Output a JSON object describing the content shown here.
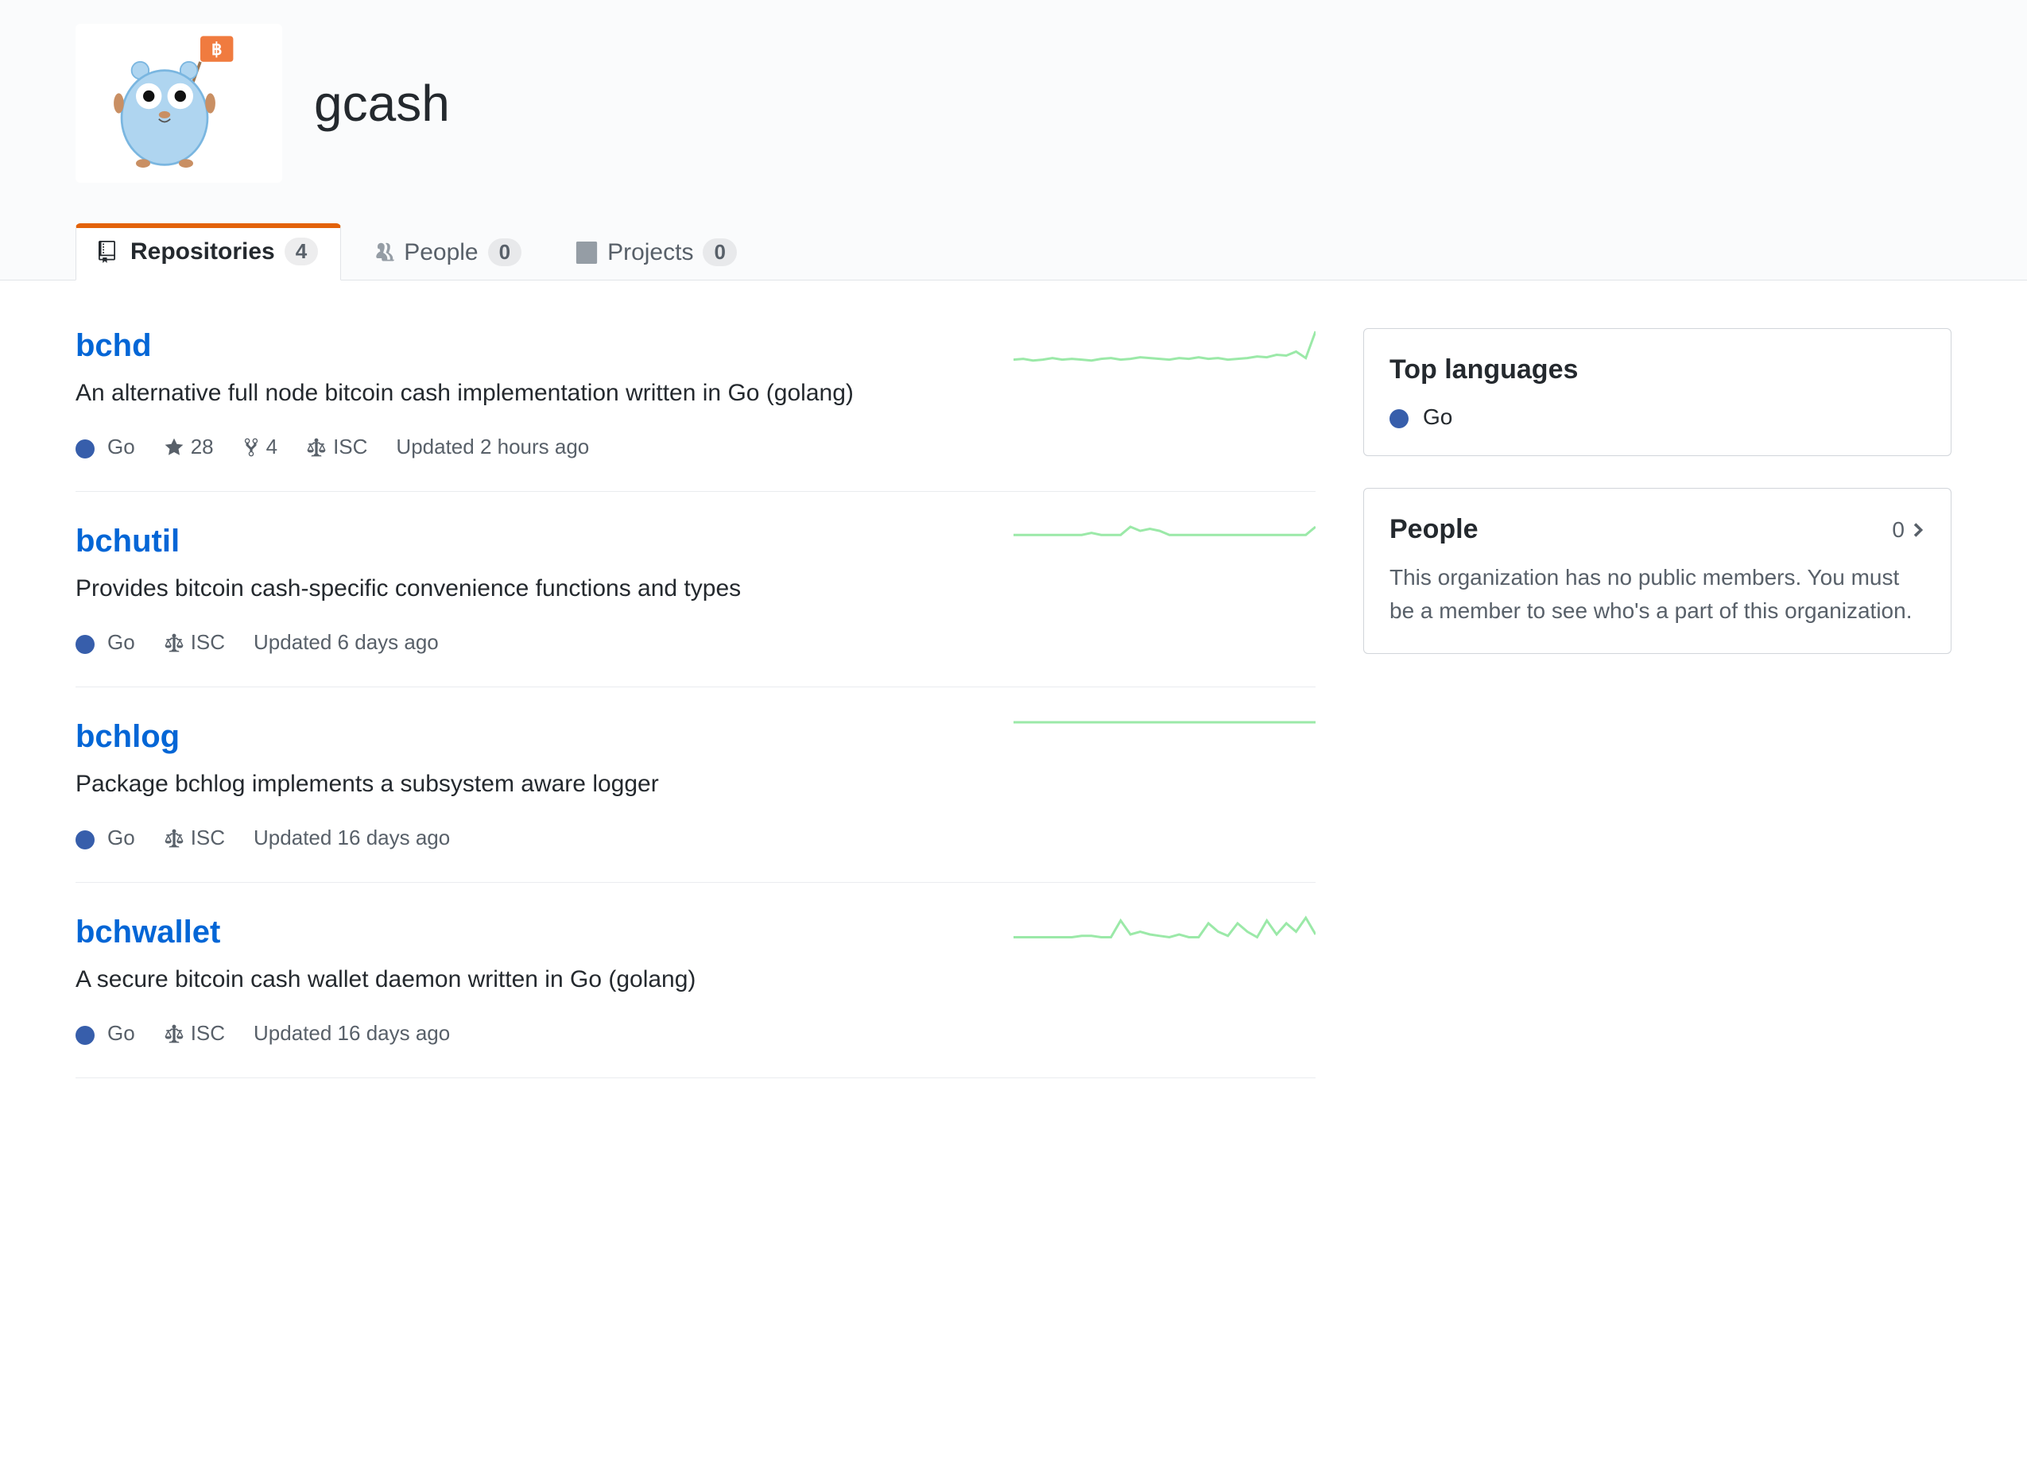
{
  "org": {
    "name": "gcash"
  },
  "tabs": [
    {
      "label": "Repositories",
      "count": "4"
    },
    {
      "label": "People",
      "count": "0"
    },
    {
      "label": "Projects",
      "count": "0"
    }
  ],
  "repos": [
    {
      "name": "bchd",
      "desc": "An alternative full node bitcoin cash implementation written in Go (golang)",
      "lang": "Go",
      "langColor": "#375eab",
      "stars": "28",
      "forks": "4",
      "license": "ISC",
      "updated": "Updated 2 hours ago",
      "spark": [
        20,
        21,
        19,
        20,
        22,
        20,
        21,
        20,
        19,
        21,
        22,
        20,
        21,
        23,
        22,
        21,
        20,
        22,
        21,
        23,
        21,
        22,
        20,
        21,
        22,
        24,
        23,
        26,
        25,
        30,
        22,
        55
      ]
    },
    {
      "name": "bchutil",
      "desc": "Provides bitcoin cash-specific convenience functions and types",
      "lang": "Go",
      "langColor": "#375eab",
      "stars": "",
      "forks": "",
      "license": "ISC",
      "updated": "Updated 6 days ago",
      "spark": [
        18,
        18,
        18,
        18,
        18,
        18,
        18,
        18,
        19,
        18,
        18,
        18,
        22,
        20,
        21,
        20,
        18,
        18,
        18,
        18,
        18,
        18,
        18,
        18,
        18,
        18,
        18,
        18,
        18,
        18,
        18,
        22
      ]
    },
    {
      "name": "bchlog",
      "desc": "Package bchlog implements a subsystem aware logger",
      "lang": "Go",
      "langColor": "#375eab",
      "stars": "",
      "forks": "",
      "license": "ISC",
      "updated": "Updated 16 days ago",
      "spark": [
        18,
        18,
        18,
        18,
        18,
        18,
        18,
        18,
        18,
        18,
        18,
        18,
        18,
        18,
        18,
        18,
        18,
        18,
        18,
        18,
        18,
        18,
        18,
        18,
        18,
        18,
        18,
        18,
        18,
        18,
        18,
        18
      ]
    },
    {
      "name": "bchwallet",
      "desc": "A secure bitcoin cash wallet daemon written in Go (golang)",
      "lang": "Go",
      "langColor": "#375eab",
      "stars": "",
      "forks": "",
      "license": "ISC",
      "updated": "Updated 16 days ago",
      "spark": [
        18,
        18,
        18,
        18,
        18,
        18,
        18,
        19,
        19,
        18,
        18,
        30,
        20,
        22,
        20,
        19,
        18,
        20,
        18,
        18,
        28,
        22,
        19,
        28,
        22,
        18,
        30,
        20,
        28,
        22,
        32,
        20
      ]
    }
  ],
  "sidebar": {
    "topLanguages": {
      "title": "Top languages",
      "items": [
        {
          "name": "Go",
          "color": "#375eab"
        }
      ]
    },
    "people": {
      "title": "People",
      "count": "0",
      "body": "This organization has no public members. You must be a member to see who's a part of this organization."
    }
  }
}
